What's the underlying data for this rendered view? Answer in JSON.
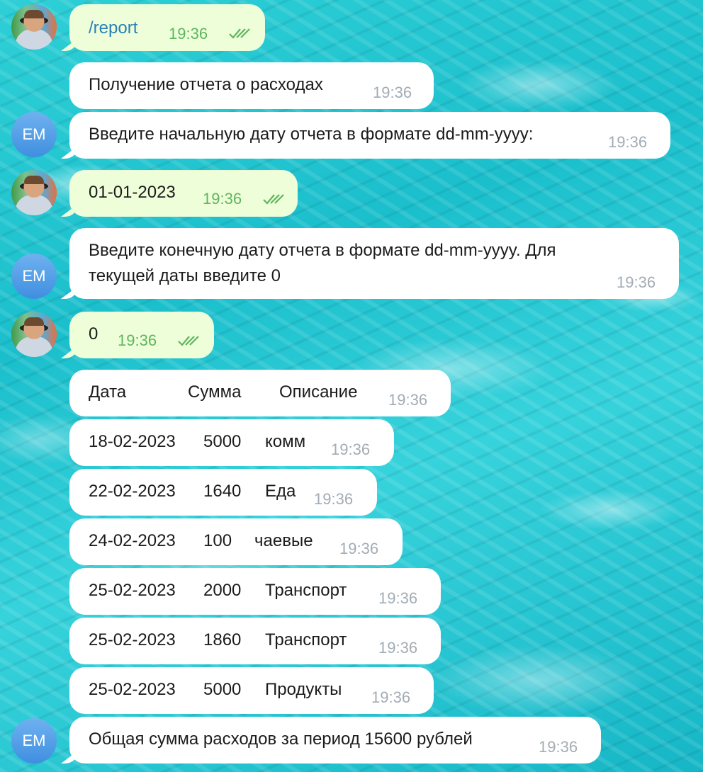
{
  "messages": [
    {
      "sender": "me",
      "text": "/report",
      "time": "19:36",
      "is_link": true
    },
    {
      "sender": "bot",
      "text": "Получение отчета о расходах",
      "time": "19:36"
    },
    {
      "sender": "bot",
      "initials": "EM",
      "text": "Введите начальную дату отчета в формате dd-mm-yyyy:",
      "time": "19:36"
    },
    {
      "sender": "me",
      "text": "01-01-2023",
      "time": "19:36"
    },
    {
      "sender": "bot",
      "initials": "EM",
      "text_line1": "Введите конечную дату отчета в формате dd-mm-yyyy. Для",
      "text_line2": "текущей даты введите 0",
      "time": "19:36"
    },
    {
      "sender": "me",
      "text": "0",
      "time": "19:36"
    },
    {
      "sender": "bot",
      "cells": [
        "Дата",
        "Сумма",
        "Описание"
      ],
      "time": "19:36"
    },
    {
      "sender": "bot",
      "cells": [
        "18-02-2023",
        "5000",
        "комм"
      ],
      "time": "19:36"
    },
    {
      "sender": "bot",
      "cells": [
        "22-02-2023",
        "1640",
        "Еда"
      ],
      "time": "19:36"
    },
    {
      "sender": "bot",
      "cells": [
        "24-02-2023",
        "100",
        "чаевые"
      ],
      "time": "19:36"
    },
    {
      "sender": "bot",
      "cells": [
        "25-02-2023",
        "2000",
        "Транспорт"
      ],
      "time": "19:36"
    },
    {
      "sender": "bot",
      "cells": [
        "25-02-2023",
        "1860",
        "Транспорт"
      ],
      "time": "19:36"
    },
    {
      "sender": "bot",
      "cells": [
        "25-02-2023",
        "5000",
        "Продукты"
      ],
      "time": "19:36"
    },
    {
      "sender": "bot",
      "initials": "EM",
      "text": "Общая сумма расходов за период 15600 рублей",
      "time": "19:36"
    }
  ],
  "icons": {
    "avatar_me": "user-photo-avatar",
    "avatar_bot": "initials-avatar",
    "read_receipt": "double-check-icon"
  },
  "colors": {
    "incoming_bubble": "#ffffff",
    "outgoing_bubble": "#eefed9",
    "outgoing_meta": "#5eb55e",
    "incoming_meta": "#a3acb4",
    "link": "#2a7fb8",
    "avatar_bot": "#4a97e6"
  }
}
